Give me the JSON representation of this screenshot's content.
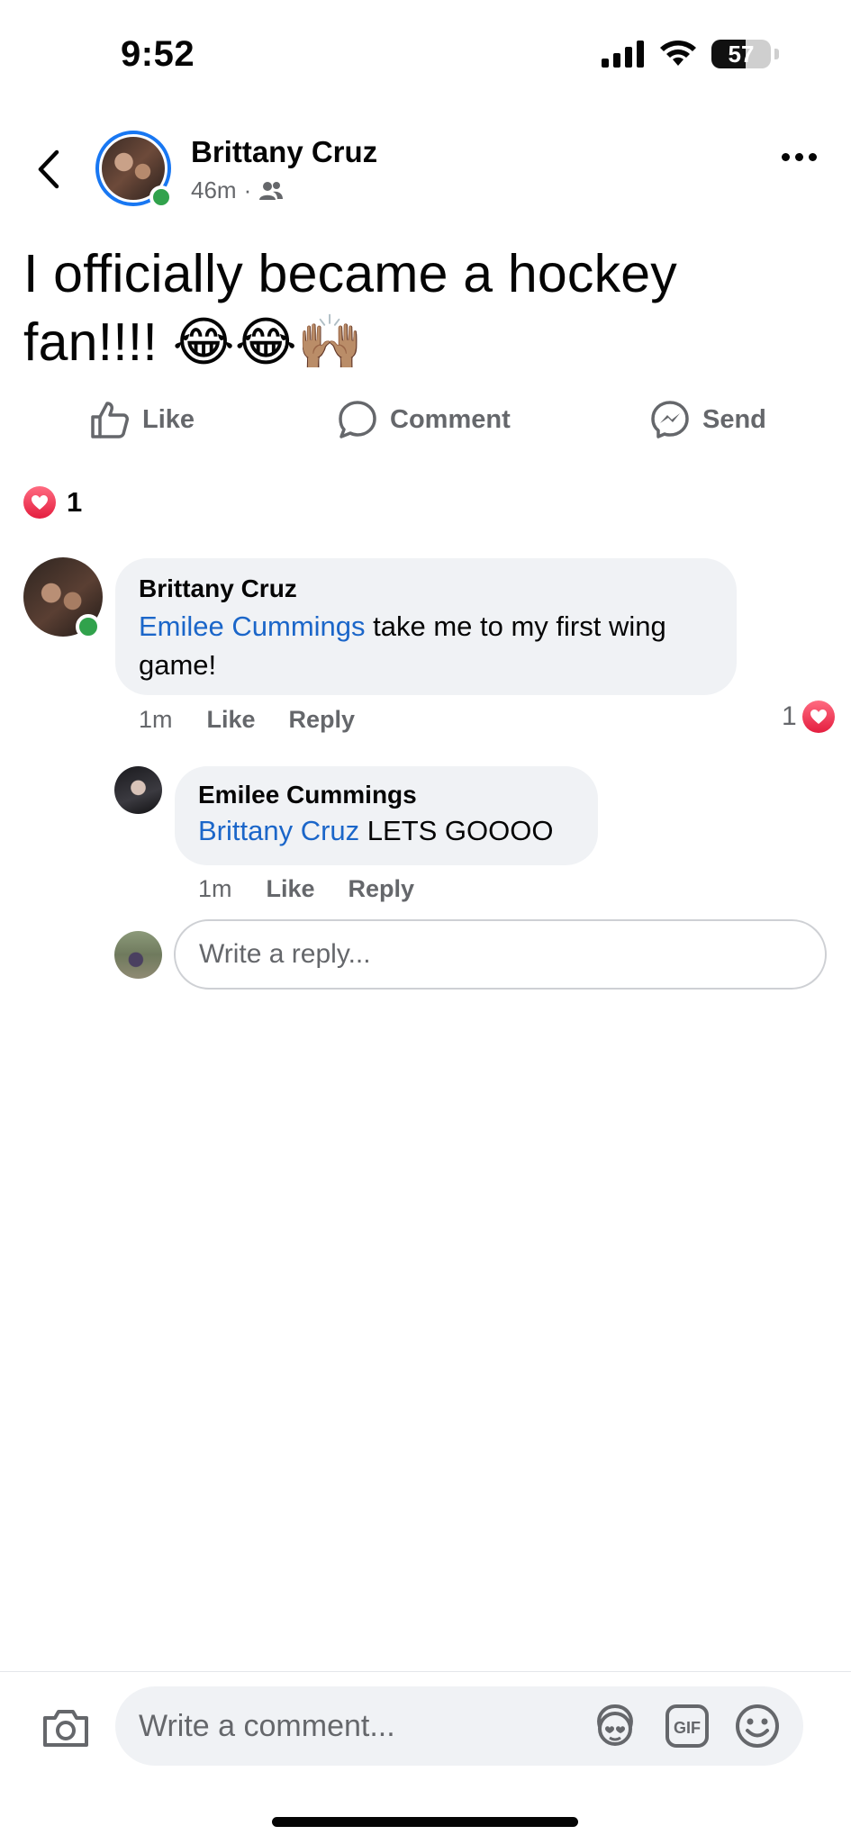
{
  "status_bar": {
    "time": "9:52",
    "battery": "57"
  },
  "post": {
    "author": "Brittany Cruz",
    "time": "46m",
    "separator": "·",
    "audience_icon": "friends-icon",
    "text": "I officially became a hockey fan!!!! 😂😂🙌🏽"
  },
  "actions": {
    "like": "Like",
    "comment": "Comment",
    "send": "Send"
  },
  "reactions": {
    "count": "1"
  },
  "comments": [
    {
      "author": "Brittany Cruz",
      "mention": "Emilee Cummings",
      "text": " take me to my first wing game!",
      "time": "1m",
      "like": "Like",
      "reply": "Reply",
      "reaction_count": "1"
    }
  ],
  "replies": [
    {
      "author": "Emilee Cummings",
      "mention": "Brittany Cruz",
      "text": " LETS GOOOO",
      "time": "1m",
      "like": "Like",
      "reply": "Reply"
    }
  ],
  "reply_box": {
    "placeholder": "Write a reply..."
  },
  "composer": {
    "placeholder": "Write a comment..."
  },
  "colors": {
    "accent": "#1877f2",
    "mention": "#1b66c9",
    "online": "#31a24c",
    "heart": "#e41e3f"
  }
}
